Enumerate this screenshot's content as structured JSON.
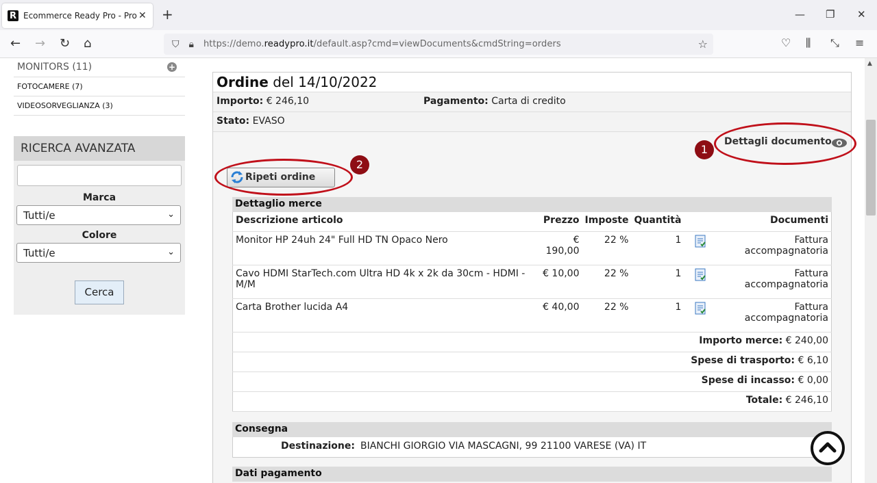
{
  "browser": {
    "tab_title": "Ecommerce Ready Pro - Prodotti",
    "url_prefix": "https://demo.",
    "url_domain": "readypro.it",
    "url_suffix": "/default.asp?cmd=viewDocuments&cmdString=orders"
  },
  "sidebar": {
    "categories": [
      {
        "label": "MONITORS (11)"
      },
      {
        "label": "FOTOCAMERE (7)"
      },
      {
        "label": "VIDEOSORVEGLIANZA (3)"
      }
    ],
    "advanced_search": {
      "title": "RICERCA AVANZATA",
      "search_value": "",
      "brand_label": "Marca",
      "brand_value": "Tutti/e",
      "color_label": "Colore",
      "color_value": "Tutti/e",
      "search_button": "Cerca"
    }
  },
  "order": {
    "title_bold": "Ordine",
    "title_rest": " del 14/10/2022",
    "amount_label": "Importo:",
    "amount_value": " € 246,10",
    "payment_label": "Pagamento:",
    "payment_value": " Carta di credito",
    "status_label": "Stato:",
    "status_value": " EVASO",
    "doc_details_link": "Dettagli documento",
    "repeat_button": "Ripeti ordine",
    "annotation_1": "1",
    "annotation_2": "2"
  },
  "goods": {
    "section_title": "Dettaglio merce",
    "headers": {
      "description": "Descrizione articolo",
      "price": "Prezzo",
      "tax": "Imposte",
      "qty": "Quantità",
      "docs": "Documenti"
    },
    "rows": [
      {
        "description": "Monitor HP 24uh 24\" Full HD TN Opaco Nero",
        "price": "€ 190,00",
        "tax": "22 %",
        "qty": "1",
        "doc": "Fattura accompagnatoria"
      },
      {
        "description": "Cavo HDMI StarTech.com Ultra HD 4k x 2k da 30cm - HDMI - M/M",
        "price": "€ 10,00",
        "tax": "22 %",
        "qty": "1",
        "doc": "Fattura accompagnatoria"
      },
      {
        "description": "Carta Brother lucida A4",
        "price": "€ 40,00",
        "tax": "22 %",
        "qty": "1",
        "doc": "Fattura accompagnatoria"
      }
    ],
    "totals": [
      {
        "label": "Importo merce:",
        "value": " € 240,00"
      },
      {
        "label": "Spese di trasporto:",
        "value": " € 6,10"
      },
      {
        "label": "Spese di incasso:",
        "value": " € 0,00"
      },
      {
        "label": "Totale:",
        "value": " € 246,10"
      }
    ]
  },
  "delivery": {
    "section_title": "Consegna",
    "dest_label": "Destinazione:",
    "dest_value": "BIANCHI GIORGIO VIA MASCAGNI, 99 21100 VARESE (VA) IT"
  },
  "payment": {
    "section_title": "Dati pagamento"
  },
  "colors": {
    "annotation": "#c0101a",
    "badge": "#8e0d14",
    "section_header": "#dcdcdc"
  },
  "icons": [
    "search-icon",
    "eye-icon",
    "refresh-icon",
    "document-icon",
    "chevron-up-icon",
    "plus-circle-icon"
  ]
}
